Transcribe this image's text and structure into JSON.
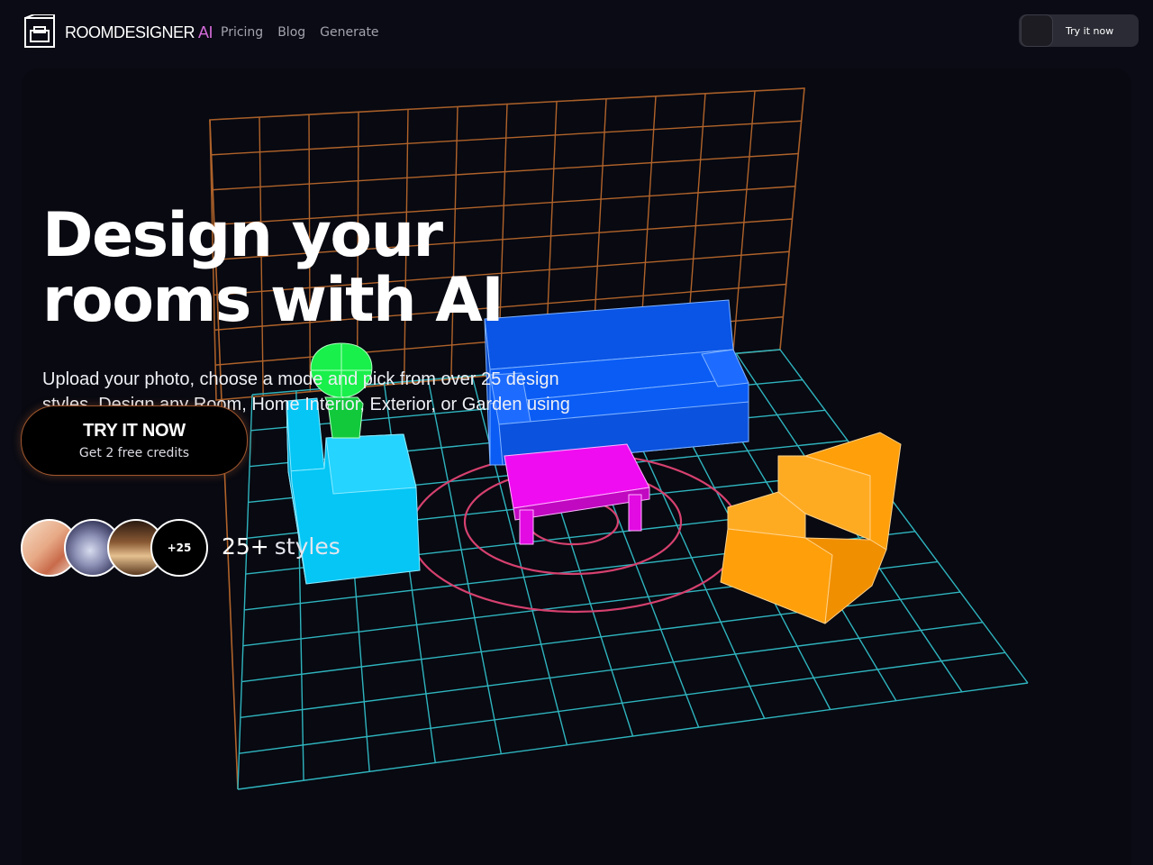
{
  "brand": {
    "name": "ROOMDESIGNER",
    "suffix": "AI",
    "accent": "#d46bd9"
  },
  "nav": {
    "links": [
      {
        "label": "Pricing"
      },
      {
        "label": "Blog"
      },
      {
        "label": "Generate"
      }
    ],
    "cta_label": "Try it now"
  },
  "hero": {
    "title_line1": "Design your",
    "title_line2": "rooms with AI",
    "subtitle": "Upload your photo, choose a mode and pick from over 25 design styles. Design any Room, Home Interior, Exterior, or Garden using with Artificial Intelligence.",
    "cta_label": "TRY IT NOW",
    "cta_sub": "Get 2 free credits",
    "avatar_more": "+25",
    "styles_count": "25+",
    "styles_word": "styles"
  },
  "colors": {
    "background": "#0a0b14",
    "wall_grid": "#b0632a",
    "floor_grid": "#2fb4be",
    "sofa": "#0a5cf5",
    "armchair_left": "#05c6f5",
    "armchair_right": "#ff9f0a",
    "table": "#f00cf0",
    "plant": "#19f04b",
    "rug": "#d6416f"
  }
}
